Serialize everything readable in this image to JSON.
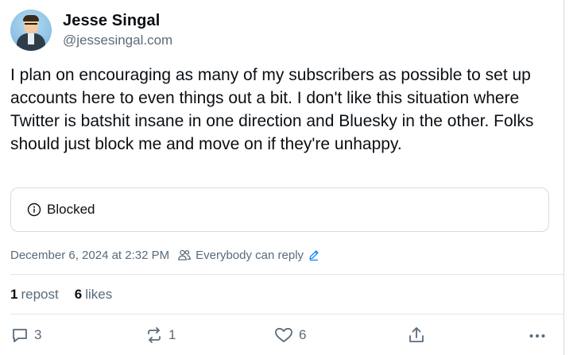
{
  "post": {
    "author_name": "Jesse Singal",
    "author_handle": "@jessesingal.com",
    "text": "I plan on encouraging as many of my subscribers as possible to set up accounts here to even things out a bit. I don't like this situation where Twitter is batshit insane in one direction and Bluesky in the other. Folks should just block me and move on if they're unhappy.",
    "embed_label": "Blocked",
    "timestamp": "December 6, 2024 at 2:32 PM",
    "reply_setting": "Everybody can reply"
  },
  "stats": {
    "reposts_count": "1",
    "reposts_label": "repost",
    "likes_count": "6",
    "likes_label": "likes"
  },
  "actions": {
    "reply_count": "3",
    "repost_count": "1",
    "like_count": "6"
  },
  "colors": {
    "text": "#0b0f14",
    "muted": "#5a6b7b",
    "accent": "#1083fe",
    "border": "#d4dbe2"
  },
  "icons": [
    "avatar",
    "info-icon",
    "people-icon",
    "pencil-icon",
    "reply-icon",
    "repost-icon",
    "like-icon",
    "share-icon",
    "more-icon"
  ]
}
